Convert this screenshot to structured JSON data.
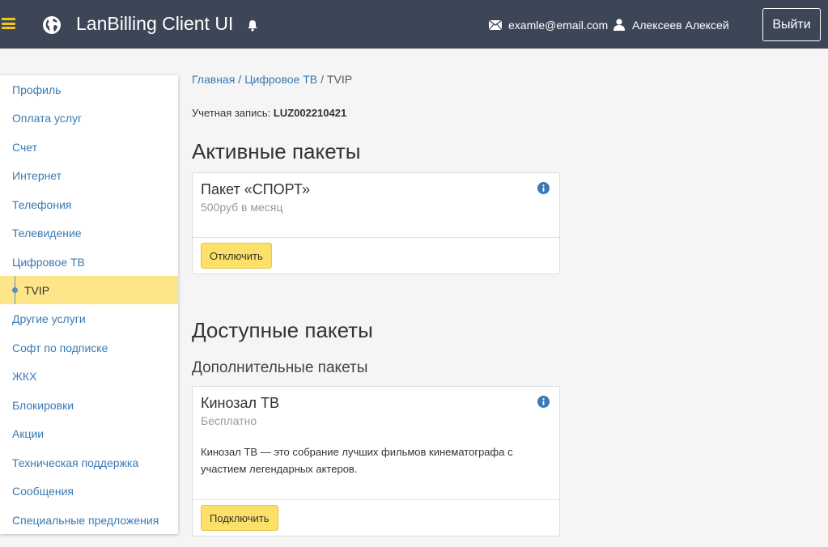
{
  "header": {
    "app_title": "LanBilling Client UI",
    "email": "examle@email.com",
    "user_name": "Алексеев Алексей",
    "logout_label": "Выйти"
  },
  "sidebar": {
    "items": [
      {
        "label": "Профиль"
      },
      {
        "label": "Оплата услуг"
      },
      {
        "label": "Счет"
      },
      {
        "label": "Интернет"
      },
      {
        "label": "Телефония"
      },
      {
        "label": "Телевидение"
      },
      {
        "label": "Цифровое ТВ"
      },
      {
        "label": "TVIP",
        "active": true
      },
      {
        "label": "Другие услуги"
      },
      {
        "label": "Софт по подписке"
      },
      {
        "label": "ЖКХ"
      },
      {
        "label": "Блокировки"
      },
      {
        "label": "Акции"
      },
      {
        "label": "Техническая поддержка"
      },
      {
        "label": "Сообщения"
      },
      {
        "label": "Специальные предложения"
      }
    ]
  },
  "breadcrumb": {
    "home": "Главная",
    "parent": "Цифровое ТВ",
    "separator": "/",
    "current": "TVIP"
  },
  "account": {
    "label": "Учетная запись:",
    "value": "LUZ002210421"
  },
  "active_section": {
    "title": "Активные пакеты",
    "packages": [
      {
        "title": "Пакет «СПОРТ»",
        "price": "500руб в месяц",
        "button": "Отключить"
      }
    ]
  },
  "available_section": {
    "title": "Доступные пакеты",
    "subtitle": "Дополнительные пакеты",
    "packages": [
      {
        "title": "Кинозал ТВ",
        "price": "Бесплатно",
        "description": "Кинозал ТВ — это собрание лучших фильмов кинематографа с участием легендарных актеров.",
        "button": "Подключить"
      }
    ]
  },
  "colors": {
    "header_bg": "#3d4657",
    "accent_yellow": "#fde068",
    "link_blue": "#3a79b5",
    "active_item_bg": "#fde68a"
  },
  "icons": {
    "menu": "hamburger-icon",
    "logo": "globe-icon",
    "notifications": "bell-icon",
    "email": "envelope-icon",
    "user": "user-icon",
    "info": "info-icon"
  }
}
